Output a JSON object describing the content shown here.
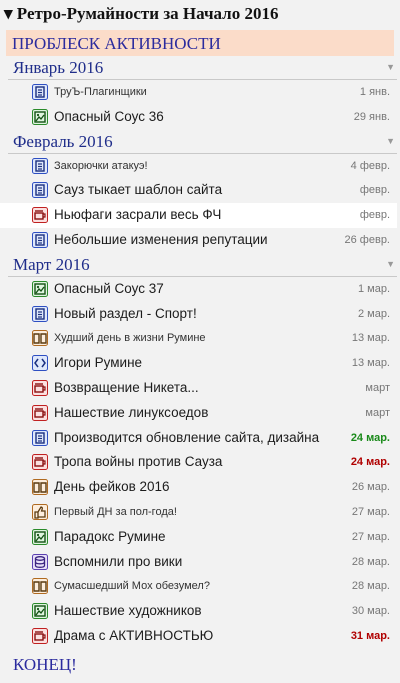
{
  "title": "▾ Ретро-Румайности за Начало 2016",
  "banner": "ПРОБЛЕСК АКТИВНОСТИ",
  "end": "КОНЕЦ!",
  "months": [
    {
      "name": "Январь 2016",
      "items": [
        {
          "icon": "doc-icon",
          "text": "ТруЪ-Плагинщики",
          "date": "1 янв.",
          "small": true
        },
        {
          "icon": "image-icon",
          "text": "Опасный Соус 36",
          "date": "29 янв."
        }
      ]
    },
    {
      "name": "Февраль 2016",
      "items": [
        {
          "icon": "doc-icon",
          "text": "Закорючки атакуэ!",
          "date": "4 февр.",
          "small": true
        },
        {
          "icon": "doc-icon",
          "text": "Сауз тыкает шаблон сайта",
          "date": "февр."
        },
        {
          "icon": "cup-icon",
          "text": "Ньюфаги засрали весь ФЧ",
          "date": "февр.",
          "highlight": true
        },
        {
          "icon": "doc-icon",
          "text": "Небольшие изменения репутации",
          "date": "26 февр."
        }
      ]
    },
    {
      "name": "Март 2016",
      "items": [
        {
          "icon": "image-icon",
          "text": "Опасный Соус 37",
          "date": "1 мар."
        },
        {
          "icon": "doc-icon",
          "text": "Новый раздел - Спорт!",
          "date": "2 мар."
        },
        {
          "icon": "book-icon",
          "text": "Худший день в жизни Румине",
          "date": "13 мар.",
          "small": true
        },
        {
          "icon": "code-icon",
          "text": "Игори Румине",
          "date": "13 мар."
        },
        {
          "icon": "cup-icon",
          "text": "Возвращение Никета...",
          "date": "март"
        },
        {
          "icon": "cup-icon",
          "text": "Нашествие линуксоедов",
          "date": "март"
        },
        {
          "icon": "doc-icon",
          "text": "Производится обновление сайта, дизайна",
          "date": "24 мар.",
          "dateStyle": "green"
        },
        {
          "icon": "cup-icon",
          "text": "Тропа войны против Сауза",
          "date": "24 мар.",
          "dateStyle": "red"
        },
        {
          "icon": "book-icon",
          "text": "День фейков 2016",
          "date": "26 мар."
        },
        {
          "icon": "thumb-icon",
          "text": "Первый ДН за пол-года!",
          "date": "27 мар.",
          "small": true
        },
        {
          "icon": "image-icon",
          "text": "Парадокс Румине",
          "date": "27 мар."
        },
        {
          "icon": "db-icon",
          "text": "Вспомнили про вики",
          "date": "28 мар."
        },
        {
          "icon": "book-icon",
          "text": "Сумасшедший Мох обезумел?",
          "date": "28 мар.",
          "small": true
        },
        {
          "icon": "image-icon",
          "text": "Нашествие художников",
          "date": "30 мар."
        },
        {
          "icon": "cup-icon",
          "text": "Драма с АКТИВНОСТЬЮ",
          "date": "31 мар.",
          "dateStyle": "red"
        }
      ]
    }
  ],
  "colors": {
    "doc-icon": {
      "bg": "#dfe8fb",
      "border": "#2e4fc2"
    },
    "image-icon": {
      "bg": "#dff5df",
      "border": "#2a8a2a"
    },
    "cup-icon": {
      "bg": "#fbe0e0",
      "border": "#c02020"
    },
    "book-icon": {
      "bg": "#fdeedd",
      "border": "#b06a20"
    },
    "code-icon": {
      "bg": "#dfe8fb",
      "border": "#2e4fc2"
    },
    "thumb-icon": {
      "bg": "#fdeedd",
      "border": "#b06a20"
    },
    "db-icon": {
      "bg": "#e8e0f8",
      "border": "#5a3fb0"
    }
  }
}
